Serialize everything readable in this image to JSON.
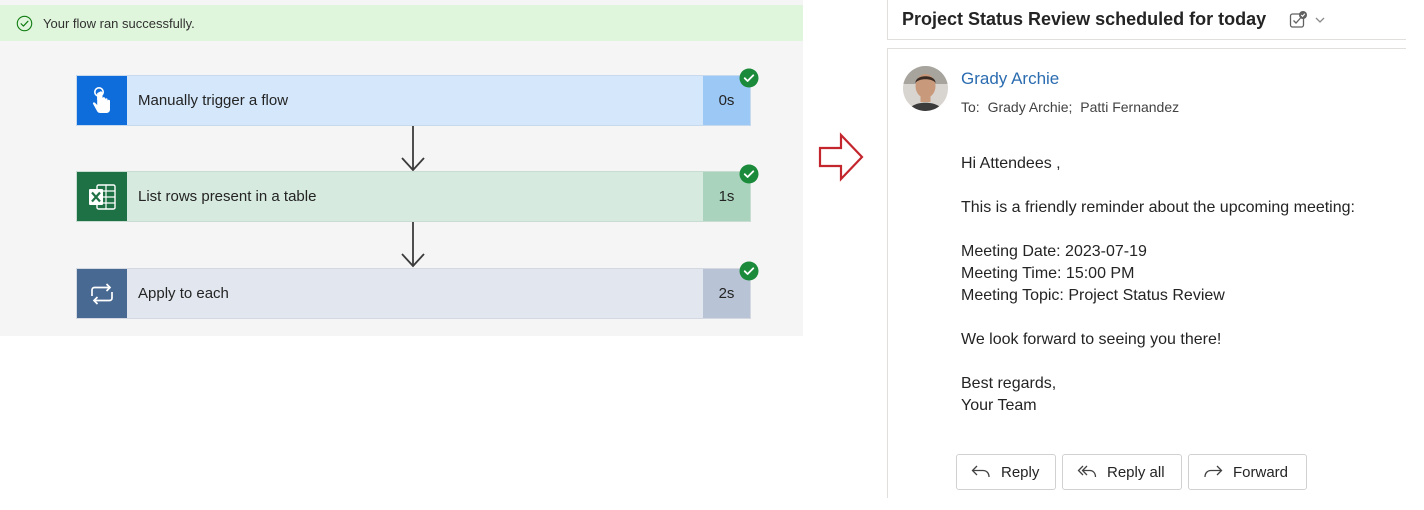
{
  "flow": {
    "status_message": "Your flow ran successfully.",
    "steps": [
      {
        "title": "Manually trigger a flow",
        "duration": "0s",
        "icon": "touch-hand-icon"
      },
      {
        "title": "List rows present in a table",
        "duration": "1s",
        "icon": "excel-icon"
      },
      {
        "title": "Apply to each",
        "duration": "2s",
        "icon": "loop-icon"
      }
    ]
  },
  "email": {
    "subject": "Project Status Review scheduled for today",
    "sender": "Grady Archie",
    "to_label": "To:",
    "recipients": [
      "Grady Archie;",
      "Patti Fernandez"
    ],
    "greeting": "Hi Attendees ,",
    "intro": "This is a friendly reminder about the upcoming meeting:",
    "meeting_date": "Meeting Date: 2023-07-19",
    "meeting_time": "Meeting Time: 15:00 PM",
    "meeting_topic": "Meeting Topic: Project Status Review",
    "closing": "We look forward to seeing you there!",
    "signoff": "Best regards,",
    "signature": "Your Team",
    "actions": {
      "reply": "Reply",
      "reply_all": "Reply all",
      "forward": "Forward"
    }
  },
  "colors": {
    "success_bg": "#dff6dd",
    "success_check": "#107c10",
    "link_blue": "#2b6cb0",
    "arrow_red": "#c4262e"
  }
}
